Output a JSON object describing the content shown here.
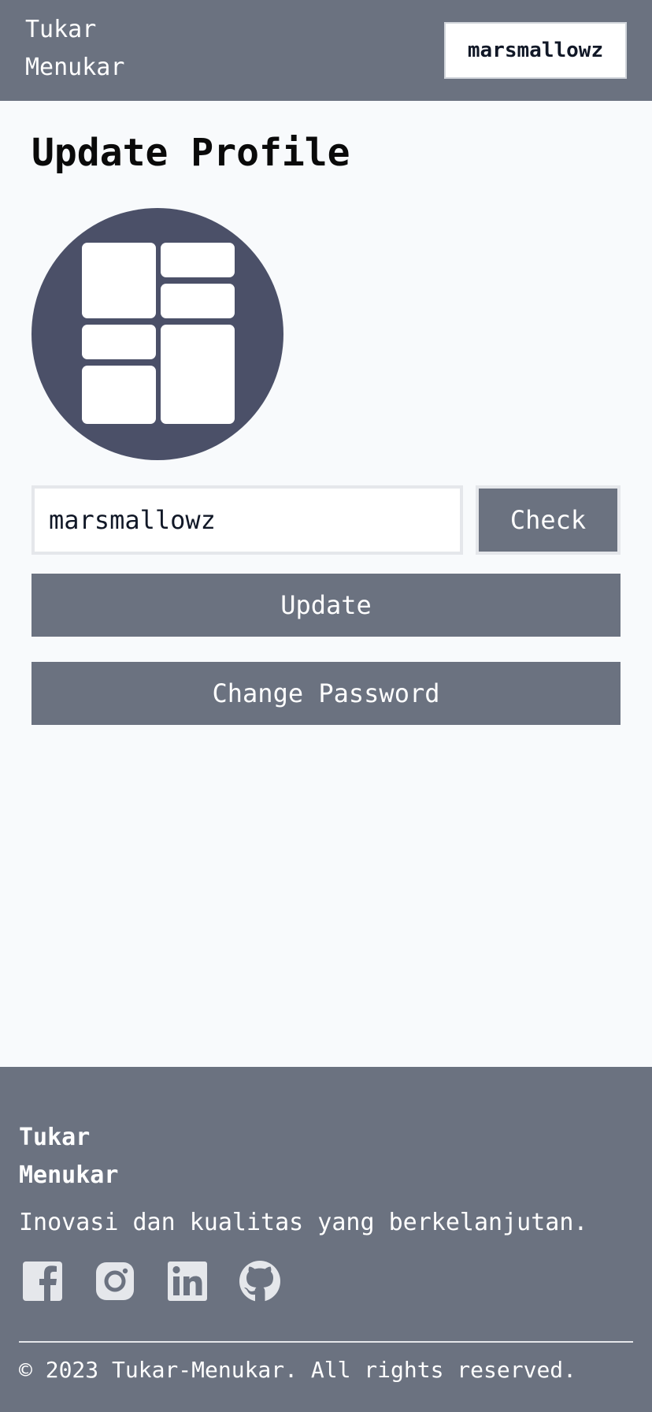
{
  "header": {
    "brand_line1": "Tukar",
    "brand_line2": "Menukar",
    "user_button": "marsmallowz"
  },
  "main": {
    "title": "Update Profile",
    "avatar_icon": "dashboard-layout-icon",
    "username_value": "marsmallowz",
    "check_label": "Check",
    "update_label": "Update",
    "change_password_label": "Change Password"
  },
  "footer": {
    "brand_line1": "Tukar",
    "brand_line2": "Menukar",
    "tagline": "Inovasi dan kualitas yang berkelanjutan.",
    "social_icons": [
      "facebook-icon",
      "instagram-icon",
      "linkedin-icon",
      "github-icon"
    ],
    "copyright": "© 2023 Tukar-Menukar. All rights reserved."
  },
  "colors": {
    "header_bg": "#6b7280",
    "page_bg": "#f8fafc",
    "button_bg": "#6b7280",
    "avatar_bg": "#4b5068",
    "icon_fill": "#e5e7eb"
  }
}
